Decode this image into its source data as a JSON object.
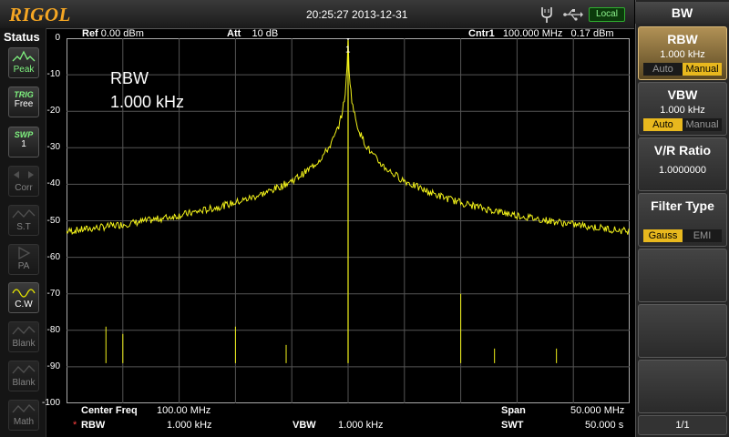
{
  "topbar": {
    "brand": "RIGOL",
    "datetime": "20:25:27 2013-12-31",
    "local": "Local"
  },
  "status": {
    "title": "Status",
    "buttons": [
      {
        "top": "",
        "bottom": "Peak"
      },
      {
        "top": "TRIG",
        "bottom": "Free"
      },
      {
        "top": "SWP",
        "bottom": "1"
      },
      {
        "top": "",
        "bottom": "Corr"
      },
      {
        "top": "",
        "bottom": "S.T"
      },
      {
        "top": "",
        "bottom": "PA"
      },
      {
        "top": "",
        "bottom": "C.W"
      },
      {
        "top": "",
        "bottom": "Blank"
      },
      {
        "top": "",
        "bottom": "Blank"
      },
      {
        "top": "",
        "bottom": "Math"
      }
    ]
  },
  "header": {
    "ref_label": "Ref",
    "ref_value": "0.00 dBm",
    "att_label": "Att",
    "att_value": "10 dB",
    "cntr_label": "Cntr1",
    "cntr_value": "100.000 MHz",
    "cntr_level": "0.17 dBm"
  },
  "overlay": {
    "line1": "RBW",
    "line2": "1.000 kHz"
  },
  "marker_label": "1",
  "footer": {
    "center_label": "Center Freq",
    "center_value": "100.00 MHz",
    "span_label": "Span",
    "span_value": "50.000 MHz",
    "rbw_star": "*",
    "rbw_label": "RBW",
    "rbw_value": "1.000 kHz",
    "vbw_label": "VBW",
    "vbw_value": "1.000 kHz",
    "swt_label": "SWT",
    "swt_value": "50.000 s"
  },
  "menu": {
    "title": "BW",
    "rbw": {
      "label": "RBW",
      "value": "1.000 kHz",
      "opt1": "Auto",
      "opt2": "Manual"
    },
    "vbw": {
      "label": "VBW",
      "value": "1.000 kHz",
      "opt1": "Auto",
      "opt2": "Manual"
    },
    "vr": {
      "label": "V/R Ratio",
      "value": "1.0000000"
    },
    "filter": {
      "label": "Filter Type",
      "opt1": "Gauss",
      "opt2": "EMI"
    },
    "page": "1/1"
  },
  "colors": {
    "trace": "#f2f21a",
    "brand": "#f5a623",
    "active": "#e8b81e"
  },
  "chart_data": {
    "type": "line",
    "y_ticks": [
      "0",
      "-10",
      "-20",
      "-30",
      "-40",
      "-50",
      "-60",
      "-70",
      "-80",
      "-90",
      "-100"
    ],
    "ylim": [
      -100,
      0
    ],
    "xlim_mhz": [
      75,
      125
    ],
    "grid": true,
    "noise_floor_dbm": -89,
    "peak": {
      "x_mhz": 100.0,
      "y_dbm": 0.17
    },
    "spurs": [
      {
        "x_mhz": 78.5,
        "y_dbm": -79
      },
      {
        "x_mhz": 80.0,
        "y_dbm": -81
      },
      {
        "x_mhz": 90.0,
        "y_dbm": -79
      },
      {
        "x_mhz": 94.5,
        "y_dbm": -84
      },
      {
        "x_mhz": 110.0,
        "y_dbm": -70
      },
      {
        "x_mhz": 113.0,
        "y_dbm": -85
      },
      {
        "x_mhz": 118.5,
        "y_dbm": -85
      }
    ]
  }
}
